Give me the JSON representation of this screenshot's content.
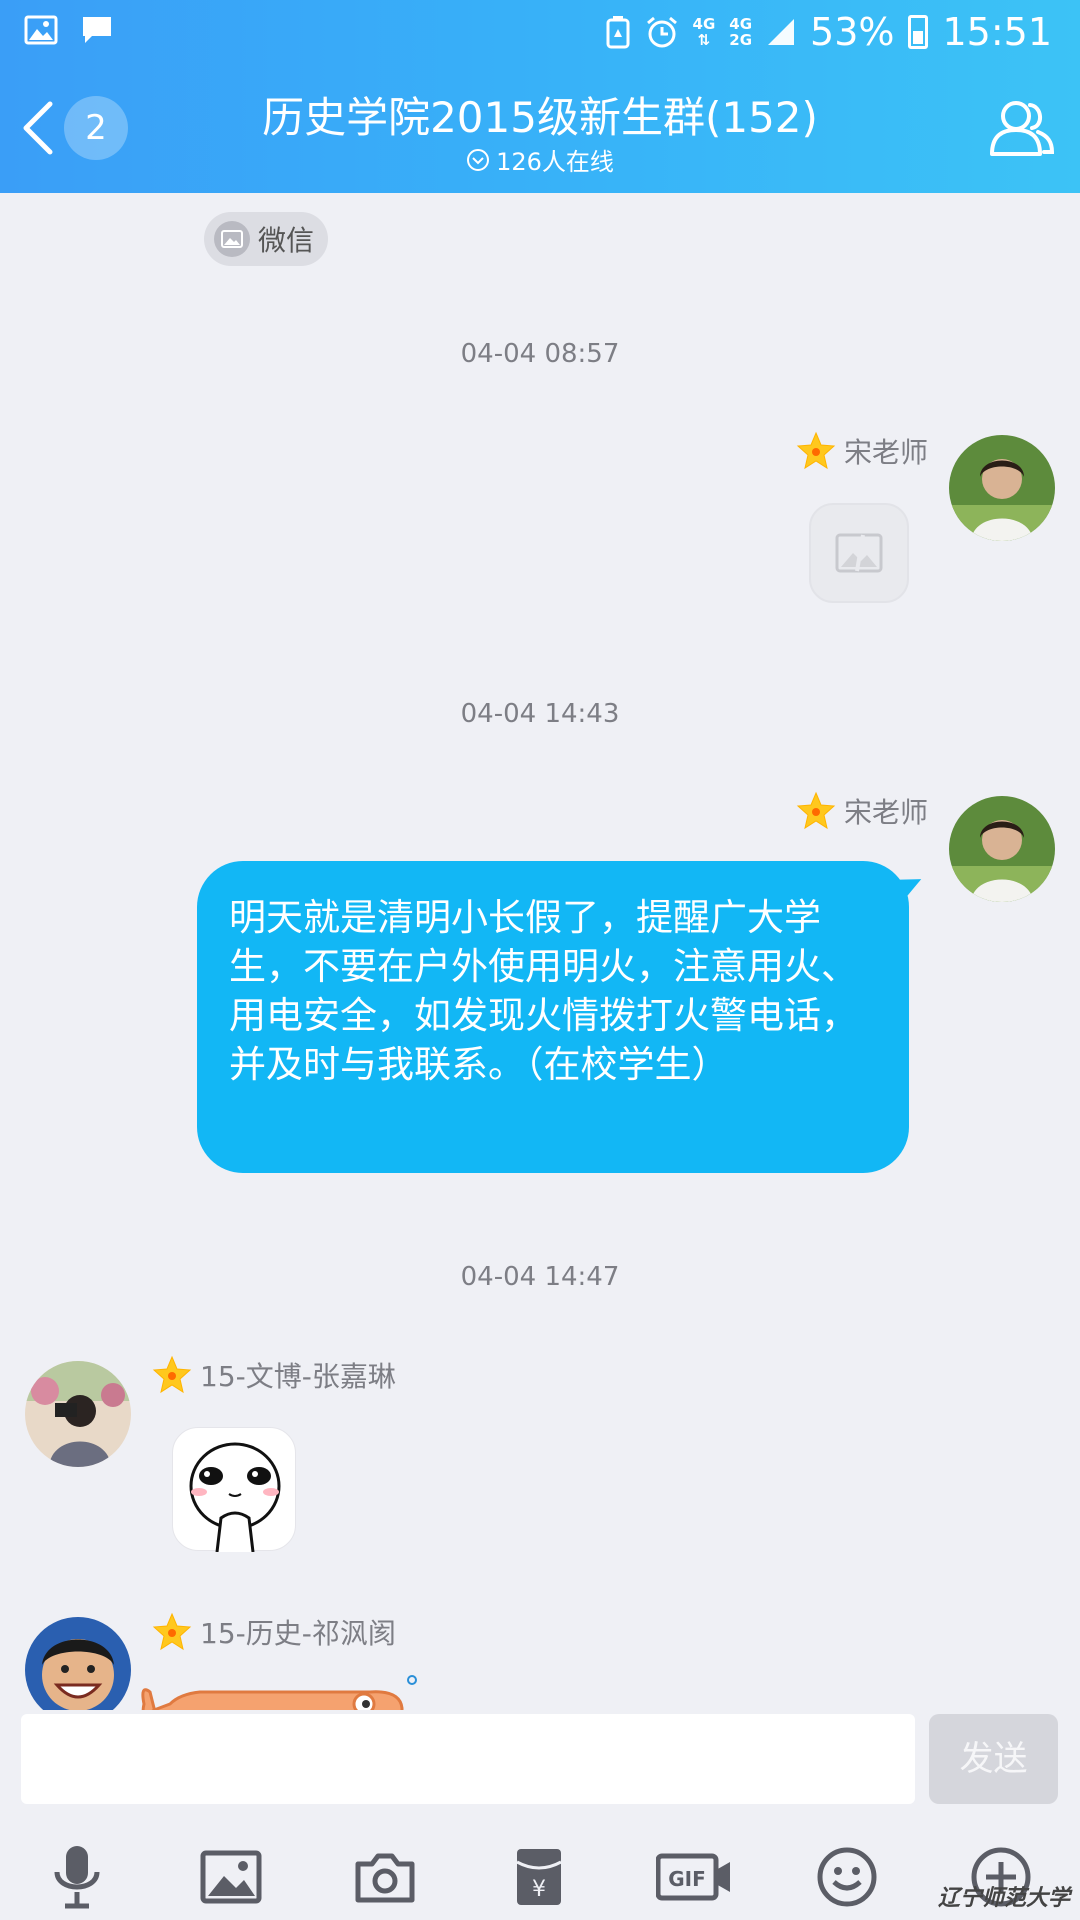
{
  "status_bar": {
    "battery": "53%",
    "time": "15:51",
    "net_top": "4G",
    "net2_top": "4G",
    "net2_bottom": "2G"
  },
  "header": {
    "unread_count": "2",
    "title": "历史学院2015级新生群(152)",
    "online": "126人在线"
  },
  "chat": {
    "wechat_chip": "微信",
    "timestamps": [
      "04-04 08:57",
      "04-04 14:43",
      "04-04 14:47"
    ],
    "messages": [
      {
        "sender": "宋老师",
        "type": "image"
      },
      {
        "sender": "宋老师",
        "type": "text",
        "text": "明天就是清明小长假了，提醒广大学生，不要在户外使用明火，注意用火、用电安全，如发现火情拨打火警电话，并及时与我联系。（在校学生）"
      },
      {
        "sender": "15-文博-张嘉琳",
        "type": "sticker"
      },
      {
        "sender": "15-历史-祁沨阂",
        "type": "sticker"
      }
    ]
  },
  "input": {
    "value": "",
    "send_label": "发送"
  },
  "toolbar_icons": [
    "mic-icon",
    "image-icon",
    "camera-icon",
    "red-packet-icon",
    "gif-icon",
    "emoji-icon",
    "plus-icon"
  ],
  "watermark": "辽宁师范大学",
  "colors": {
    "header_start": "#3a9ef7",
    "header_end": "#3cc3f6",
    "bubble": "#12b7f5",
    "background": "#eff0f5"
  }
}
